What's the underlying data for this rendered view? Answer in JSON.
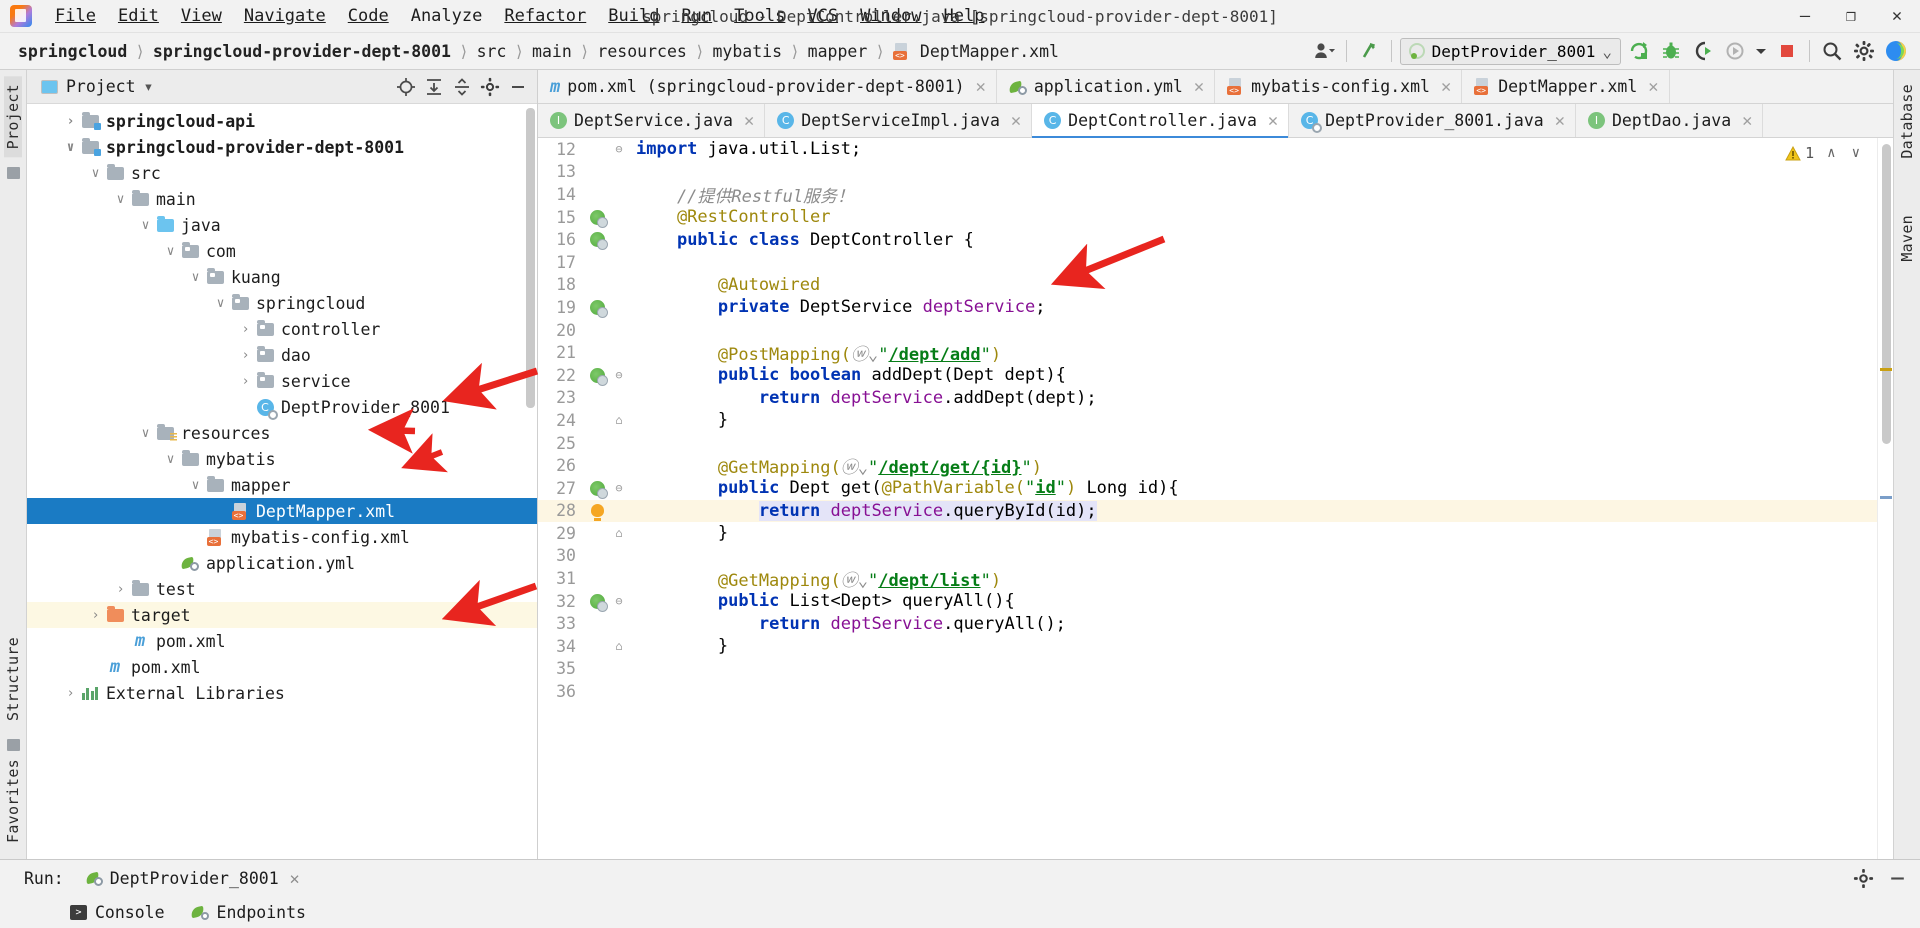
{
  "window": {
    "title": "springcloud - DeptController.java [springcloud-provider-dept-8001]",
    "minimize": "—",
    "maximize": "❐",
    "close": "✕"
  },
  "menu": [
    {
      "label": "File"
    },
    {
      "label": "Edit"
    },
    {
      "label": "View"
    },
    {
      "label": "Navigate"
    },
    {
      "label": "Code"
    },
    {
      "label": "Analyze"
    },
    {
      "label": "Refactor"
    },
    {
      "label": "Build"
    },
    {
      "label": "Run"
    },
    {
      "label": "Tools"
    },
    {
      "label": "VCS"
    },
    {
      "label": "Window"
    },
    {
      "label": "Help"
    }
  ],
  "breadcrumbs": [
    {
      "label": "springcloud",
      "bold": true
    },
    {
      "label": "springcloud-provider-dept-8001",
      "bold": true
    },
    {
      "label": "src",
      "bold": false
    },
    {
      "label": "main",
      "bold": false
    },
    {
      "label": "resources",
      "bold": false
    },
    {
      "label": "mybatis",
      "bold": false
    },
    {
      "label": "mapper",
      "bold": false
    },
    {
      "label": "DeptMapper.xml",
      "bold": false
    }
  ],
  "toolbar": {
    "run_config": "DeptProvider_8001",
    "dropdown_caret": "⌄",
    "icons": {
      "user": "user-icon",
      "update": "update-icon",
      "run": "run-icon",
      "debug": "debug-icon",
      "coverage": "coverage-icon",
      "profile": "profile-icon",
      "stop": "stop-icon",
      "search": "search-icon",
      "settings": "settings-icon",
      "help": "ide-logo-icon"
    }
  },
  "left_strip": {
    "project_label": "Project",
    "structure_label": "Structure",
    "favorites_label": "Favorites"
  },
  "right_strip": {
    "database_label": "Database",
    "maven_label": "Maven"
  },
  "project_panel": {
    "title": "Project",
    "caret": "▾",
    "tree": [
      {
        "label": "springcloud-api",
        "depth": 1,
        "arrow": "collapsed",
        "icon": "module-folder",
        "bold": true,
        "state": "normal"
      },
      {
        "label": "springcloud-provider-dept-8001",
        "depth": 1,
        "arrow": "expanded",
        "icon": "module-folder",
        "bold": true,
        "state": "normal"
      },
      {
        "label": "src",
        "depth": 2,
        "arrow": "expanded",
        "icon": "folder",
        "bold": false,
        "state": "normal"
      },
      {
        "label": "main",
        "depth": 3,
        "arrow": "expanded",
        "icon": "folder",
        "bold": false,
        "state": "normal"
      },
      {
        "label": "java",
        "depth": 4,
        "arrow": "expanded",
        "icon": "source-folder",
        "bold": false,
        "state": "normal"
      },
      {
        "label": "com",
        "depth": 5,
        "arrow": "expanded",
        "icon": "package",
        "bold": false,
        "state": "normal"
      },
      {
        "label": "kuang",
        "depth": 6,
        "arrow": "expanded",
        "icon": "package",
        "bold": false,
        "state": "normal"
      },
      {
        "label": "springcloud",
        "depth": 7,
        "arrow": "expanded",
        "icon": "package",
        "bold": false,
        "state": "normal"
      },
      {
        "label": "controller",
        "depth": 8,
        "arrow": "collapsed",
        "icon": "package",
        "bold": false,
        "state": "normal"
      },
      {
        "label": "dao",
        "depth": 8,
        "arrow": "collapsed",
        "icon": "package",
        "bold": false,
        "state": "normal"
      },
      {
        "label": "service",
        "depth": 8,
        "arrow": "collapsed",
        "icon": "package",
        "bold": false,
        "state": "normal"
      },
      {
        "label": "DeptProvider_8001",
        "depth": 8,
        "arrow": "none",
        "icon": "spring-class",
        "bold": false,
        "state": "normal"
      },
      {
        "label": "resources",
        "depth": 4,
        "arrow": "expanded",
        "icon": "resource-folder",
        "bold": false,
        "state": "normal"
      },
      {
        "label": "mybatis",
        "depth": 5,
        "arrow": "expanded",
        "icon": "folder",
        "bold": false,
        "state": "normal"
      },
      {
        "label": "mapper",
        "depth": 6,
        "arrow": "expanded",
        "icon": "folder",
        "bold": false,
        "state": "normal"
      },
      {
        "label": "DeptMapper.xml",
        "depth": 7,
        "arrow": "none",
        "icon": "xml",
        "bold": false,
        "state": "selected"
      },
      {
        "label": "mybatis-config.xml",
        "depth": 6,
        "arrow": "none",
        "icon": "xml",
        "bold": false,
        "state": "normal"
      },
      {
        "label": "application.yml",
        "depth": 5,
        "arrow": "none",
        "icon": "yml",
        "bold": false,
        "state": "normal"
      },
      {
        "label": "test",
        "depth": 3,
        "arrow": "collapsed",
        "icon": "folder",
        "bold": false,
        "state": "normal"
      },
      {
        "label": "target",
        "depth": 2,
        "arrow": "collapsed",
        "icon": "target-folder",
        "bold": false,
        "state": "highlight"
      },
      {
        "label": "pom.xml",
        "depth": 3,
        "arrow": "none",
        "icon": "maven",
        "bold": false,
        "state": "normal"
      },
      {
        "label": "pom.xml",
        "depth": 2,
        "arrow": "none",
        "icon": "maven",
        "bold": false,
        "state": "normal"
      },
      {
        "label": "External Libraries",
        "depth": 1,
        "arrow": "collapsed",
        "icon": "library",
        "bold": false,
        "state": "normal"
      }
    ]
  },
  "editor": {
    "tabs_row1": [
      {
        "label": "pom.xml (springcloud-provider-dept-8001)",
        "icon": "maven",
        "active": false,
        "close": "✕"
      },
      {
        "label": "application.yml",
        "icon": "yml",
        "active": false,
        "close": "✕"
      },
      {
        "label": "mybatis-config.xml",
        "icon": "xml",
        "active": false,
        "close": "✕"
      },
      {
        "label": "DeptMapper.xml",
        "icon": "xml",
        "active": false,
        "close": "✕"
      }
    ],
    "tabs_row2": [
      {
        "label": "DeptService.java",
        "icon": "interface",
        "active": false,
        "close": "✕"
      },
      {
        "label": "DeptServiceImpl.java",
        "icon": "class",
        "active": false,
        "close": "✕"
      },
      {
        "label": "DeptController.java",
        "icon": "class",
        "active": true,
        "close": "✕"
      },
      {
        "label": "DeptProvider_8001.java",
        "icon": "spring-class",
        "active": false,
        "close": "✕"
      },
      {
        "label": "DeptDao.java",
        "icon": "interface",
        "active": false,
        "close": "✕"
      }
    ],
    "inspection": {
      "warning_count": "1",
      "up": "∧",
      "down": "∨"
    },
    "lines": [
      {
        "num": "12",
        "gutter": "fold-start",
        "marker": "",
        "current": false,
        "tokens": [
          {
            "t": "import",
            "c": "kw"
          },
          {
            "t": " java.util.List;",
            "c": "idl"
          }
        ]
      },
      {
        "num": "13",
        "gutter": "",
        "marker": "",
        "current": false,
        "tokens": []
      },
      {
        "num": "14",
        "gutter": "",
        "marker": "",
        "current": false,
        "tokens": [
          {
            "t": "    //提供Restful服务！",
            "c": "cmt"
          }
        ]
      },
      {
        "num": "15",
        "gutter": "",
        "marker": "run-spring",
        "current": false,
        "tokens": [
          {
            "t": "    @RestController",
            "c": "ann"
          }
        ]
      },
      {
        "num": "16",
        "gutter": "",
        "marker": "run-spring",
        "current": false,
        "tokens": [
          {
            "t": "    ",
            "c": "idl"
          },
          {
            "t": "public",
            "c": "kw"
          },
          {
            "t": " ",
            "c": "idl"
          },
          {
            "t": "class",
            "c": "kw"
          },
          {
            "t": " DeptController {",
            "c": "idl"
          }
        ]
      },
      {
        "num": "17",
        "gutter": "",
        "marker": "",
        "current": false,
        "tokens": []
      },
      {
        "num": "18",
        "gutter": "",
        "marker": "",
        "current": false,
        "tokens": [
          {
            "t": "        @Autowired",
            "c": "ann"
          }
        ]
      },
      {
        "num": "19",
        "gutter": "",
        "marker": "run-spring",
        "current": false,
        "tokens": [
          {
            "t": "        ",
            "c": "idl"
          },
          {
            "t": "private",
            "c": "kw"
          },
          {
            "t": " DeptService ",
            "c": "idl"
          },
          {
            "t": "deptService",
            "c": "fld"
          },
          {
            "t": ";",
            "c": "idl"
          }
        ]
      },
      {
        "num": "20",
        "gutter": "",
        "marker": "",
        "current": false,
        "tokens": []
      },
      {
        "num": "21",
        "gutter": "",
        "marker": "",
        "current": false,
        "tokens": [
          {
            "t": "        @PostMapping(",
            "c": "ann"
          },
          {
            "t": "ⓦ⌄",
            "c": "cmt"
          },
          {
            "t": "\"",
            "c": "str"
          },
          {
            "t": "/dept/add",
            "c": "strlink"
          },
          {
            "t": "\"",
            "c": "str"
          },
          {
            "t": ")",
            "c": "ann"
          }
        ]
      },
      {
        "num": "22",
        "gutter": "fold-start",
        "marker": "run-spring",
        "current": false,
        "tokens": [
          {
            "t": "        ",
            "c": "idl"
          },
          {
            "t": "public",
            "c": "kw"
          },
          {
            "t": " ",
            "c": "idl"
          },
          {
            "t": "boolean",
            "c": "kw"
          },
          {
            "t": " addDept(Dept dept){",
            "c": "idl"
          }
        ]
      },
      {
        "num": "23",
        "gutter": "",
        "marker": "",
        "current": false,
        "tokens": [
          {
            "t": "            ",
            "c": "idl"
          },
          {
            "t": "return",
            "c": "kw"
          },
          {
            "t": " ",
            "c": "idl"
          },
          {
            "t": "deptService",
            "c": "fld"
          },
          {
            "t": ".addDept(dept);",
            "c": "idl"
          }
        ]
      },
      {
        "num": "24",
        "gutter": "fold-end",
        "marker": "",
        "current": false,
        "tokens": [
          {
            "t": "        }",
            "c": "idl"
          }
        ]
      },
      {
        "num": "25",
        "gutter": "",
        "marker": "",
        "current": false,
        "tokens": []
      },
      {
        "num": "26",
        "gutter": "",
        "marker": "",
        "current": false,
        "tokens": [
          {
            "t": "        @GetMapping(",
            "c": "ann"
          },
          {
            "t": "ⓦ⌄",
            "c": "cmt"
          },
          {
            "t": "\"",
            "c": "str"
          },
          {
            "t": "/dept/get/{id}",
            "c": "strlink"
          },
          {
            "t": "\"",
            "c": "str"
          },
          {
            "t": ")",
            "c": "ann"
          }
        ]
      },
      {
        "num": "27",
        "gutter": "fold-start",
        "marker": "run-spring",
        "current": false,
        "tokens": [
          {
            "t": "        ",
            "c": "idl"
          },
          {
            "t": "public",
            "c": "kw"
          },
          {
            "t": " Dept get(",
            "c": "idl"
          },
          {
            "t": "@PathVariable(",
            "c": "ann"
          },
          {
            "t": "\"",
            "c": "str"
          },
          {
            "t": "id",
            "c": "strlink"
          },
          {
            "t": "\"",
            "c": "str"
          },
          {
            "t": ")",
            "c": "ann"
          },
          {
            "t": " Long id){",
            "c": "idl"
          }
        ]
      },
      {
        "num": "28",
        "gutter": "",
        "marker": "bulb",
        "current": true,
        "tokens": [
          {
            "t": "            ",
            "c": "idl"
          },
          {
            "t": "return",
            "c": "kw"
          },
          {
            "t": " ",
            "c": "idl"
          },
          {
            "t": "deptService",
            "c": "fld"
          },
          {
            "t": ".queryById(id);",
            "c": "idl"
          }
        ]
      },
      {
        "num": "29",
        "gutter": "fold-end",
        "marker": "",
        "current": false,
        "tokens": [
          {
            "t": "        }",
            "c": "idl"
          }
        ]
      },
      {
        "num": "30",
        "gutter": "",
        "marker": "",
        "current": false,
        "tokens": []
      },
      {
        "num": "31",
        "gutter": "",
        "marker": "",
        "current": false,
        "tokens": [
          {
            "t": "        @GetMapping(",
            "c": "ann"
          },
          {
            "t": "ⓦ⌄",
            "c": "cmt"
          },
          {
            "t": "\"",
            "c": "str"
          },
          {
            "t": "/dept/list",
            "c": "strlink"
          },
          {
            "t": "\"",
            "c": "str"
          },
          {
            "t": ")",
            "c": "ann"
          }
        ]
      },
      {
        "num": "32",
        "gutter": "fold-start",
        "marker": "run-spring",
        "current": false,
        "tokens": [
          {
            "t": "        ",
            "c": "idl"
          },
          {
            "t": "public",
            "c": "kw"
          },
          {
            "t": " List<Dept> queryAll(){",
            "c": "idl"
          }
        ]
      },
      {
        "num": "33",
        "gutter": "",
        "marker": "",
        "current": false,
        "tokens": [
          {
            "t": "            ",
            "c": "idl"
          },
          {
            "t": "return",
            "c": "kw"
          },
          {
            "t": " ",
            "c": "idl"
          },
          {
            "t": "deptService",
            "c": "fld"
          },
          {
            "t": ".queryAll();",
            "c": "idl"
          }
        ]
      },
      {
        "num": "34",
        "gutter": "fold-end",
        "marker": "",
        "current": false,
        "tokens": [
          {
            "t": "        }",
            "c": "idl"
          }
        ]
      },
      {
        "num": "35",
        "gutter": "",
        "marker": "",
        "current": false,
        "tokens": []
      },
      {
        "num": "36",
        "gutter": "",
        "marker": "",
        "current": false,
        "tokens": []
      }
    ]
  },
  "run_panel": {
    "label": "Run:",
    "config_name": "DeptProvider_8001",
    "close": "✕",
    "tabs": [
      {
        "label": "Console",
        "icon": "console-icon"
      },
      {
        "label": "Endpoints",
        "icon": "endpoints-icon"
      }
    ],
    "settings_icon": "gear-icon",
    "hide_icon": "minimize-icon"
  },
  "colors": {
    "selection_blue": "#1a7bc4",
    "current_line": "#fdf6e3",
    "annotation_red": "#e8251f",
    "keyword_blue": "#0033b3",
    "string_green": "#067d17",
    "annotation_gold": "#9e880d",
    "field_purple": "#871094"
  }
}
